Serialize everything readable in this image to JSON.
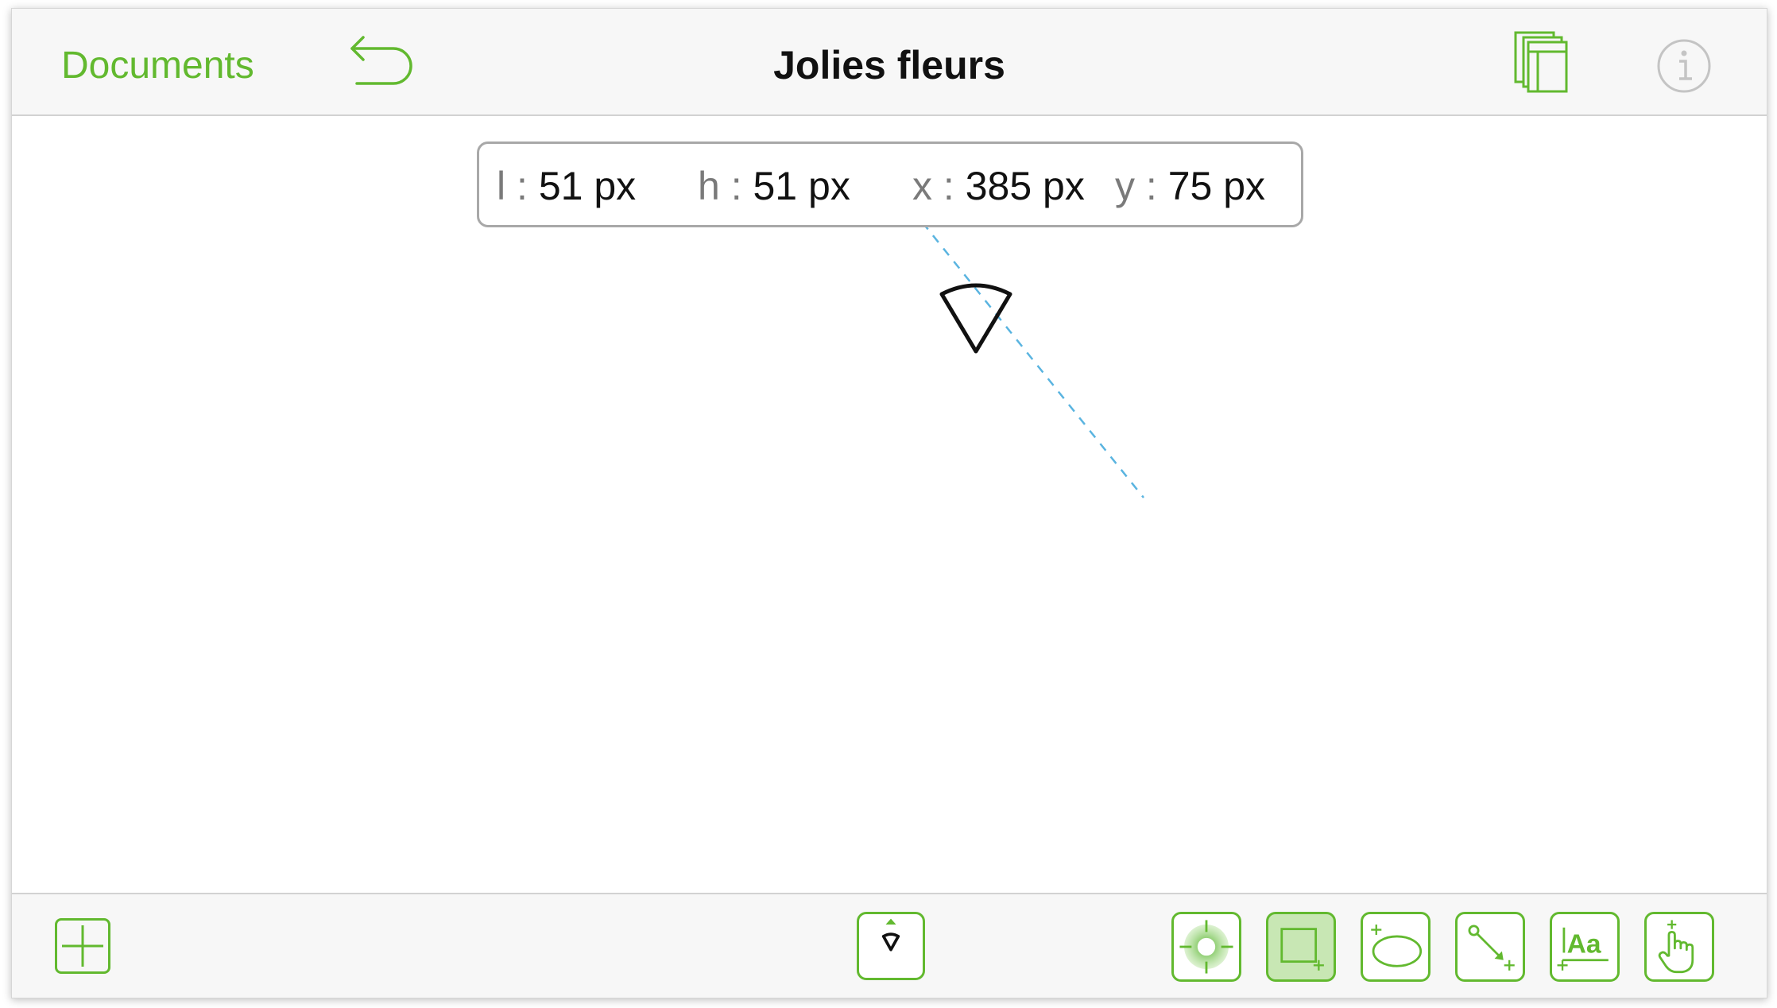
{
  "nav": {
    "documents_label": "Documents",
    "title": "Jolies fleurs",
    "undo_icon": "undo-arrow-icon",
    "layers_icon": "layers-icon",
    "info_icon": "info-icon"
  },
  "dimensions": {
    "l_key": "l :",
    "l_value": "51 px",
    "h_key": "h :",
    "h_value": "51 px",
    "x_key": "x :",
    "x_value": "385 px",
    "y_key": "y :",
    "y_value": "75 px"
  },
  "toolbar": {
    "add_icon": "add-canvas-icon",
    "tools": [
      {
        "name": "shape-tool",
        "icon": "shape-icon",
        "selected": false
      },
      {
        "name": "style-tool",
        "icon": "style-target-icon",
        "selected": false
      },
      {
        "name": "rectangle-tool",
        "icon": "rectangle-plus-icon",
        "selected": true
      },
      {
        "name": "lasso-tool",
        "icon": "lasso-plus-icon",
        "selected": false
      },
      {
        "name": "line-tool",
        "icon": "line-plus-icon",
        "selected": false
      },
      {
        "name": "text-tool",
        "icon": "text-aa-icon",
        "selected": false
      },
      {
        "name": "touch-tool",
        "icon": "hand-pointer-icon",
        "selected": false
      }
    ],
    "text_tool_label": "Aa"
  },
  "colors": {
    "accent": "#62b92f",
    "accent_light": "#c8e7b4",
    "guide": "#5ab4e0",
    "text": "#111111",
    "muted": "#7a7a7a"
  }
}
